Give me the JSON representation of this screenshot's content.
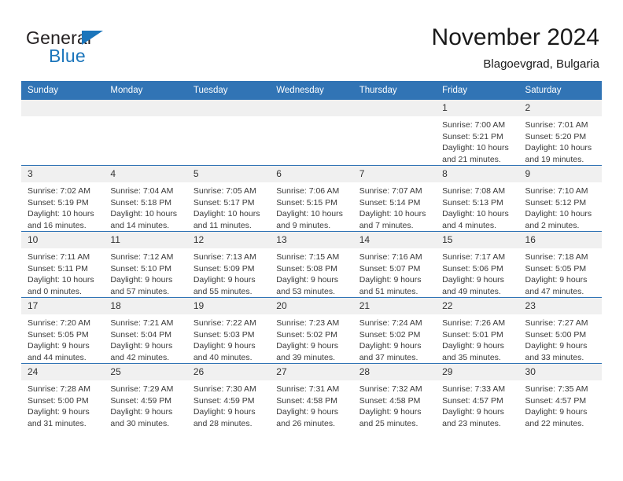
{
  "brand": {
    "name_part1": "General",
    "name_part2": "Blue"
  },
  "header": {
    "title": "November 2024",
    "subtitle": "Blagoevgrad, Bulgaria"
  },
  "colors": {
    "header_blue": "#3174b5",
    "logo_blue": "#1b75bb",
    "daynum_band": "#f0f0f0",
    "text": "#3a3a3a"
  },
  "weekdays": [
    "Sunday",
    "Monday",
    "Tuesday",
    "Wednesday",
    "Thursday",
    "Friday",
    "Saturday"
  ],
  "weeks": [
    [
      {
        "day": "",
        "sunrise": "",
        "sunset": "",
        "daylight1": "",
        "daylight2": ""
      },
      {
        "day": "",
        "sunrise": "",
        "sunset": "",
        "daylight1": "",
        "daylight2": ""
      },
      {
        "day": "",
        "sunrise": "",
        "sunset": "",
        "daylight1": "",
        "daylight2": ""
      },
      {
        "day": "",
        "sunrise": "",
        "sunset": "",
        "daylight1": "",
        "daylight2": ""
      },
      {
        "day": "",
        "sunrise": "",
        "sunset": "",
        "daylight1": "",
        "daylight2": ""
      },
      {
        "day": "1",
        "sunrise": "Sunrise: 7:00 AM",
        "sunset": "Sunset: 5:21 PM",
        "daylight1": "Daylight: 10 hours",
        "daylight2": "and 21 minutes."
      },
      {
        "day": "2",
        "sunrise": "Sunrise: 7:01 AM",
        "sunset": "Sunset: 5:20 PM",
        "daylight1": "Daylight: 10 hours",
        "daylight2": "and 19 minutes."
      }
    ],
    [
      {
        "day": "3",
        "sunrise": "Sunrise: 7:02 AM",
        "sunset": "Sunset: 5:19 PM",
        "daylight1": "Daylight: 10 hours",
        "daylight2": "and 16 minutes."
      },
      {
        "day": "4",
        "sunrise": "Sunrise: 7:04 AM",
        "sunset": "Sunset: 5:18 PM",
        "daylight1": "Daylight: 10 hours",
        "daylight2": "and 14 minutes."
      },
      {
        "day": "5",
        "sunrise": "Sunrise: 7:05 AM",
        "sunset": "Sunset: 5:17 PM",
        "daylight1": "Daylight: 10 hours",
        "daylight2": "and 11 minutes."
      },
      {
        "day": "6",
        "sunrise": "Sunrise: 7:06 AM",
        "sunset": "Sunset: 5:15 PM",
        "daylight1": "Daylight: 10 hours",
        "daylight2": "and 9 minutes."
      },
      {
        "day": "7",
        "sunrise": "Sunrise: 7:07 AM",
        "sunset": "Sunset: 5:14 PM",
        "daylight1": "Daylight: 10 hours",
        "daylight2": "and 7 minutes."
      },
      {
        "day": "8",
        "sunrise": "Sunrise: 7:08 AM",
        "sunset": "Sunset: 5:13 PM",
        "daylight1": "Daylight: 10 hours",
        "daylight2": "and 4 minutes."
      },
      {
        "day": "9",
        "sunrise": "Sunrise: 7:10 AM",
        "sunset": "Sunset: 5:12 PM",
        "daylight1": "Daylight: 10 hours",
        "daylight2": "and 2 minutes."
      }
    ],
    [
      {
        "day": "10",
        "sunrise": "Sunrise: 7:11 AM",
        "sunset": "Sunset: 5:11 PM",
        "daylight1": "Daylight: 10 hours",
        "daylight2": "and 0 minutes."
      },
      {
        "day": "11",
        "sunrise": "Sunrise: 7:12 AM",
        "sunset": "Sunset: 5:10 PM",
        "daylight1": "Daylight: 9 hours",
        "daylight2": "and 57 minutes."
      },
      {
        "day": "12",
        "sunrise": "Sunrise: 7:13 AM",
        "sunset": "Sunset: 5:09 PM",
        "daylight1": "Daylight: 9 hours",
        "daylight2": "and 55 minutes."
      },
      {
        "day": "13",
        "sunrise": "Sunrise: 7:15 AM",
        "sunset": "Sunset: 5:08 PM",
        "daylight1": "Daylight: 9 hours",
        "daylight2": "and 53 minutes."
      },
      {
        "day": "14",
        "sunrise": "Sunrise: 7:16 AM",
        "sunset": "Sunset: 5:07 PM",
        "daylight1": "Daylight: 9 hours",
        "daylight2": "and 51 minutes."
      },
      {
        "day": "15",
        "sunrise": "Sunrise: 7:17 AM",
        "sunset": "Sunset: 5:06 PM",
        "daylight1": "Daylight: 9 hours",
        "daylight2": "and 49 minutes."
      },
      {
        "day": "16",
        "sunrise": "Sunrise: 7:18 AM",
        "sunset": "Sunset: 5:05 PM",
        "daylight1": "Daylight: 9 hours",
        "daylight2": "and 47 minutes."
      }
    ],
    [
      {
        "day": "17",
        "sunrise": "Sunrise: 7:20 AM",
        "sunset": "Sunset: 5:05 PM",
        "daylight1": "Daylight: 9 hours",
        "daylight2": "and 44 minutes."
      },
      {
        "day": "18",
        "sunrise": "Sunrise: 7:21 AM",
        "sunset": "Sunset: 5:04 PM",
        "daylight1": "Daylight: 9 hours",
        "daylight2": "and 42 minutes."
      },
      {
        "day": "19",
        "sunrise": "Sunrise: 7:22 AM",
        "sunset": "Sunset: 5:03 PM",
        "daylight1": "Daylight: 9 hours",
        "daylight2": "and 40 minutes."
      },
      {
        "day": "20",
        "sunrise": "Sunrise: 7:23 AM",
        "sunset": "Sunset: 5:02 PM",
        "daylight1": "Daylight: 9 hours",
        "daylight2": "and 39 minutes."
      },
      {
        "day": "21",
        "sunrise": "Sunrise: 7:24 AM",
        "sunset": "Sunset: 5:02 PM",
        "daylight1": "Daylight: 9 hours",
        "daylight2": "and 37 minutes."
      },
      {
        "day": "22",
        "sunrise": "Sunrise: 7:26 AM",
        "sunset": "Sunset: 5:01 PM",
        "daylight1": "Daylight: 9 hours",
        "daylight2": "and 35 minutes."
      },
      {
        "day": "23",
        "sunrise": "Sunrise: 7:27 AM",
        "sunset": "Sunset: 5:00 PM",
        "daylight1": "Daylight: 9 hours",
        "daylight2": "and 33 minutes."
      }
    ],
    [
      {
        "day": "24",
        "sunrise": "Sunrise: 7:28 AM",
        "sunset": "Sunset: 5:00 PM",
        "daylight1": "Daylight: 9 hours",
        "daylight2": "and 31 minutes."
      },
      {
        "day": "25",
        "sunrise": "Sunrise: 7:29 AM",
        "sunset": "Sunset: 4:59 PM",
        "daylight1": "Daylight: 9 hours",
        "daylight2": "and 30 minutes."
      },
      {
        "day": "26",
        "sunrise": "Sunrise: 7:30 AM",
        "sunset": "Sunset: 4:59 PM",
        "daylight1": "Daylight: 9 hours",
        "daylight2": "and 28 minutes."
      },
      {
        "day": "27",
        "sunrise": "Sunrise: 7:31 AM",
        "sunset": "Sunset: 4:58 PM",
        "daylight1": "Daylight: 9 hours",
        "daylight2": "and 26 minutes."
      },
      {
        "day": "28",
        "sunrise": "Sunrise: 7:32 AM",
        "sunset": "Sunset: 4:58 PM",
        "daylight1": "Daylight: 9 hours",
        "daylight2": "and 25 minutes."
      },
      {
        "day": "29",
        "sunrise": "Sunrise: 7:33 AM",
        "sunset": "Sunset: 4:57 PM",
        "daylight1": "Daylight: 9 hours",
        "daylight2": "and 23 minutes."
      },
      {
        "day": "30",
        "sunrise": "Sunrise: 7:35 AM",
        "sunset": "Sunset: 4:57 PM",
        "daylight1": "Daylight: 9 hours",
        "daylight2": "and 22 minutes."
      }
    ]
  ]
}
